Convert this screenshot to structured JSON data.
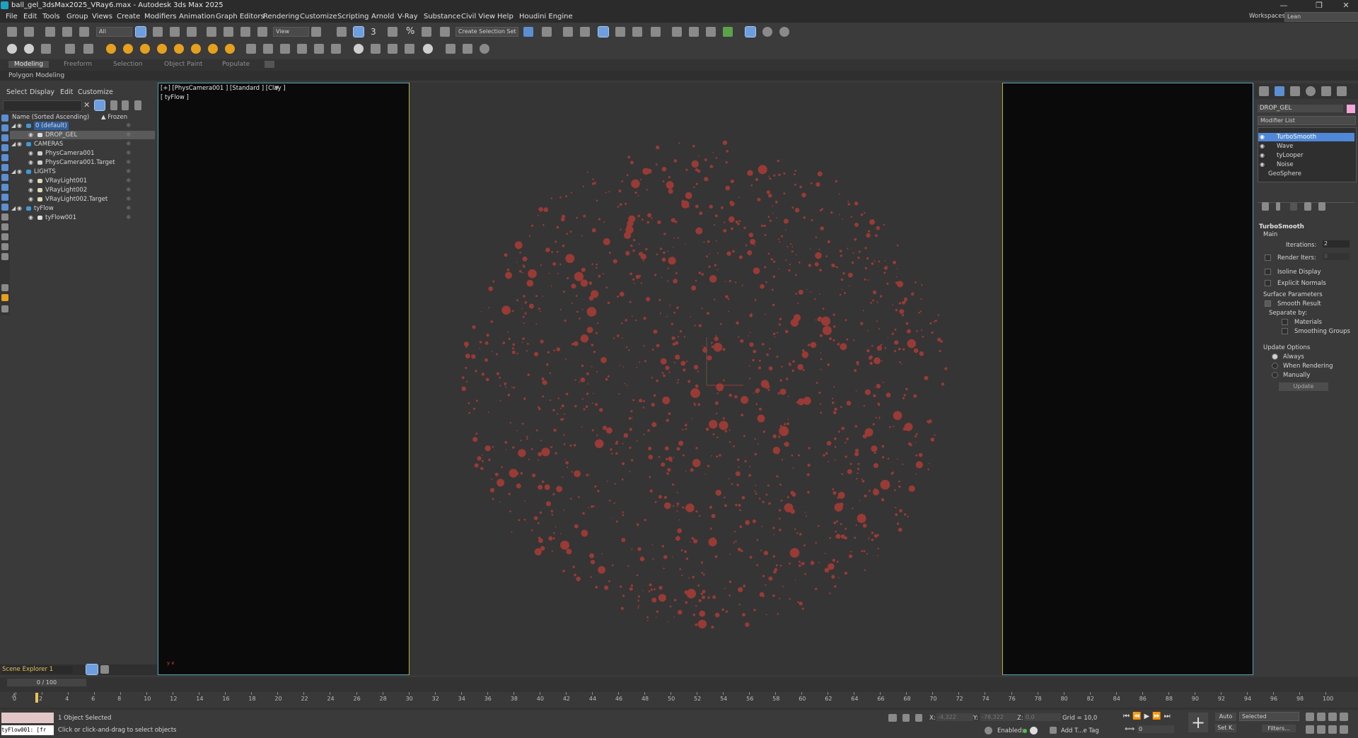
{
  "window": {
    "title": "ball_gel_3dsMax2025_VRay6.max - Autodesk 3ds Max 2025",
    "minimize": "—",
    "maximize": "❐",
    "close": "✕"
  },
  "menu": [
    "File",
    "Edit",
    "Tools",
    "Group",
    "Views",
    "Create",
    "Modifiers",
    "Animation",
    "Graph Editors",
    "Rendering",
    "Customize",
    "Scripting",
    "Arnold",
    "V-Ray",
    "Substance",
    "Civil View",
    "Help",
    "Houdini Engine"
  ],
  "workspace": {
    "label": "Workspaces:",
    "value": "Lean"
  },
  "toolbar": {
    "selection_filter": "All",
    "ref_coord": "View",
    "create_selection_set": "Create Selection Set",
    "percent_snap": "%",
    "snap_3": "3"
  },
  "ribbon": {
    "tabs": [
      "Modeling",
      "Freeform",
      "Selection",
      "Object Paint",
      "Populate"
    ],
    "active": "Modeling",
    "panel": "Polygon Modeling"
  },
  "explorer": {
    "menu": [
      "Select",
      "Display",
      "Edit",
      "Customize"
    ],
    "col_name": "Name (Sorted Ascending)",
    "col_frozen": "▲ Frozen",
    "rows": [
      {
        "name": "0 (default)",
        "level": 1,
        "kind": "layer"
      },
      {
        "name": "DROP_GEL",
        "level": 2,
        "kind": "object"
      },
      {
        "name": "CAMERAS",
        "level": 1,
        "kind": "layer"
      },
      {
        "name": "PhysCamera001",
        "level": 2,
        "kind": "camera"
      },
      {
        "name": "PhysCamera001.Target",
        "level": 2,
        "kind": "camera"
      },
      {
        "name": "LIGHTS",
        "level": 1,
        "kind": "layer"
      },
      {
        "name": "VRayLight001",
        "level": 2,
        "kind": "light"
      },
      {
        "name": "VRayLight002",
        "level": 2,
        "kind": "light"
      },
      {
        "name": "VRayLight002.Target",
        "level": 2,
        "kind": "light"
      },
      {
        "name": "tyFlow",
        "level": 1,
        "kind": "layer"
      },
      {
        "name": "tyFlow001",
        "level": 2,
        "kind": "object"
      }
    ],
    "selected_row": 1,
    "footer": "Scene Explorer 1"
  },
  "viewport": {
    "label": "[+] [PhysCamera001 ] [Standard ] [Clay ]",
    "sublabel": "[ tyFlow ]",
    "axis": "y  x",
    "particle_color": "#9a3a34"
  },
  "command_panel": {
    "object_name": "DROP_GEL",
    "object_color": "#f0a8d8",
    "modifier_list": "Modifier List",
    "stack": [
      "TurboSmooth",
      "Wave",
      "tyLooper",
      "Noise",
      "GeoSphere"
    ],
    "stack_selected": 0,
    "rollout": "TurboSmooth",
    "main": "Main",
    "iterations_label": "Iterations:",
    "iterations_value": "2",
    "render_iters_label": "Render Iters:",
    "render_iters_value": "0",
    "isoline": "Isoline Display",
    "explicit": "Explicit Normals",
    "surface_params": "Surface Parameters",
    "smooth_result": "Smooth Result",
    "separate_by": "Separate by:",
    "materials": "Materials",
    "smoothing_groups": "Smoothing Groups",
    "update_options": "Update Options",
    "always": "Always",
    "when_rendering": "When Rendering",
    "manually": "Manually",
    "update_btn": "Update"
  },
  "timeline": {
    "frame_display": "0 / 100",
    "ticks": [
      "0",
      "2",
      "4",
      "6",
      "8",
      "10",
      "12",
      "14",
      "16",
      "18",
      "20",
      "22",
      "24",
      "26",
      "28",
      "30",
      "32",
      "34",
      "36",
      "38",
      "40",
      "42",
      "44",
      "46",
      "48",
      "50",
      "52",
      "54",
      "56",
      "58",
      "60",
      "62",
      "64",
      "66",
      "68",
      "70",
      "72",
      "74",
      "76",
      "78",
      "80",
      "82",
      "84",
      "86",
      "88",
      "90",
      "92",
      "94",
      "96",
      "98",
      "100"
    ],
    "current_frame": 0
  },
  "status": {
    "selected_count": "1 Object Selected",
    "prompt": "Click or click-and-drag to select objects",
    "maxscript": "tyFlow001: [fr",
    "x_label": "X:",
    "x_value": "-4,322",
    "y_label": "Y:",
    "y_value": "-78,322",
    "z_label": "Z:",
    "z_value": "0,0",
    "grid": "Grid = 10,0",
    "enabled": "Enabled:",
    "add_time_tag": "Add T...e Tag",
    "auto": "Auto",
    "set_key": "Set K.",
    "key_mode": "Selected",
    "filters": "Filters...",
    "frame_field": "0"
  }
}
